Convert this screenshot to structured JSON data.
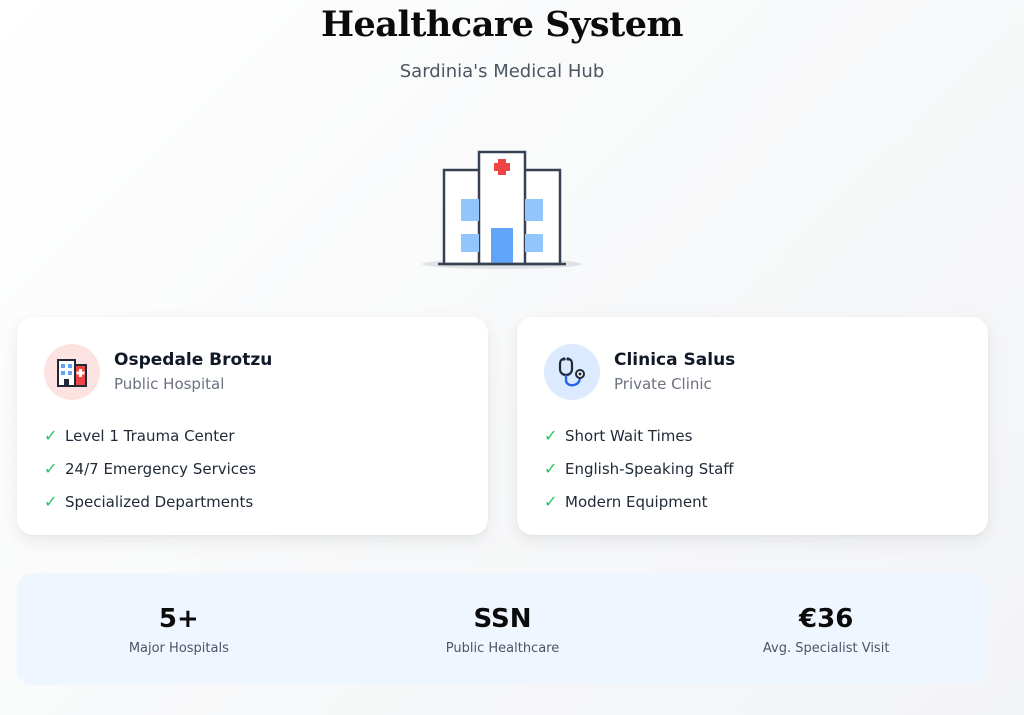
{
  "header": {
    "title": "Healthcare System",
    "subtitle": "Sardinia's Medical Hub"
  },
  "hero": {
    "icon": "hospital-building-icon",
    "accent": "#ef4444",
    "window_color": "#93c5fd",
    "door_color": "#60a5fa"
  },
  "cards": [
    {
      "name": "Ospedale Brotzu",
      "type": "Public Hospital",
      "icon": "hospital-icon",
      "icon_bg": "#fde2e2",
      "features": [
        "Level 1 Trauma Center",
        "24/7 Emergency Services",
        "Specialized Departments"
      ]
    },
    {
      "name": "Clinica Salus",
      "type": "Private Clinic",
      "icon": "stethoscope-icon",
      "icon_bg": "#dbeafe",
      "features": [
        "Short Wait Times",
        "English-Speaking Staff",
        "Modern Equipment"
      ]
    }
  ],
  "check_symbol": "✓",
  "check_color": "#22c55e",
  "stats": [
    {
      "value": "5+",
      "label": "Major Hospitals"
    },
    {
      "value": "SSN",
      "label": "Public Healthcare"
    },
    {
      "value": "€36",
      "label": "Avg. Specialist Visit"
    }
  ]
}
